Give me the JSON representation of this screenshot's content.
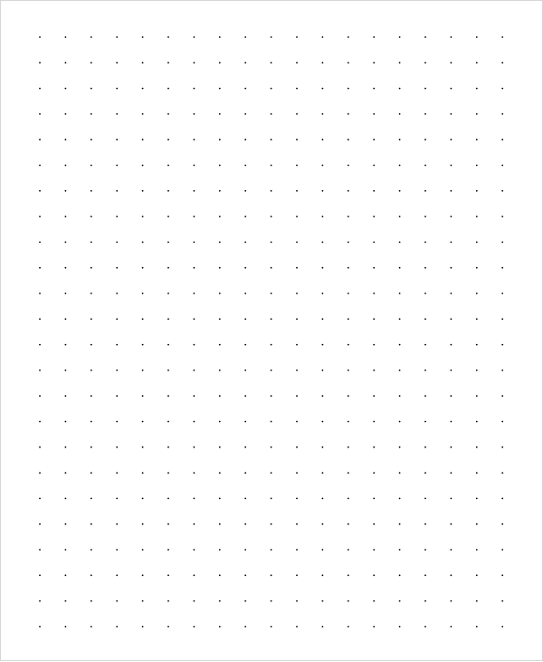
{
  "page": {
    "kind": "dot-grid-paper",
    "paper_color": "#ffffff",
    "border_color": "#d6d6d6"
  },
  "dot_grid": {
    "columns": 19,
    "rows": 24,
    "dot_color": "#000000"
  }
}
